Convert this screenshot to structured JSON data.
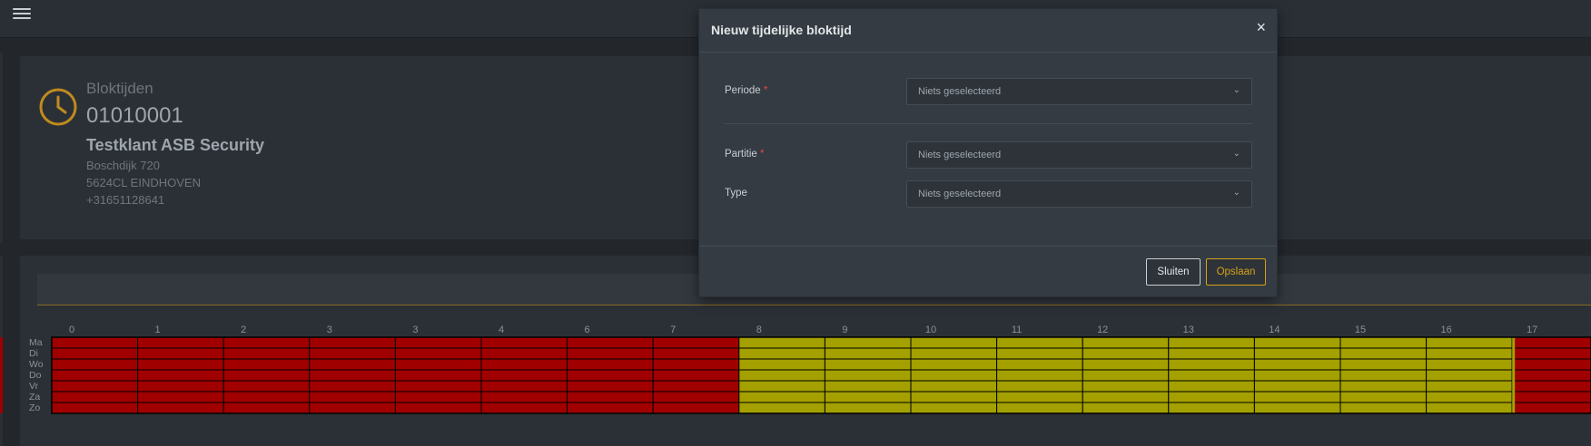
{
  "header": {
    "menu_icon": "hamburger-icon"
  },
  "info": {
    "label": "Bloktijden",
    "number": "01010001",
    "name": "Testklant ASB Security",
    "street": "Boschdijk 720",
    "city": "5624CL EINDHOVEN",
    "phone": "+31651128641",
    "icon": "clock-icon",
    "accent": "#c08a1e"
  },
  "grid": {
    "hour_labels": [
      "0",
      "1",
      "2",
      "3",
      "3",
      "4",
      "6",
      "7",
      "8",
      "9",
      "10",
      "11",
      "12",
      "13",
      "14",
      "15",
      "16",
      "17"
    ],
    "day_labels": [
      "Ma",
      "Di",
      "Wo",
      "Do",
      "Vr",
      "Za",
      "Zo"
    ],
    "colors": {
      "blocked": "#a10000",
      "open": "#a3a000"
    },
    "open_from_hour": 8,
    "open_until_hour": 17
  },
  "modal": {
    "title": "Nieuw tijdelijke bloktijd",
    "close_symbol": "×",
    "fields": [
      {
        "label": "Periode",
        "required": "*",
        "value": "Niets geselecteerd"
      },
      {
        "label": "Partitie",
        "required": "*",
        "value": "Niets geselecteerd"
      },
      {
        "label": "Type",
        "required": "",
        "value": "Niets geselecteerd"
      }
    ],
    "chevron": "⌄",
    "buttons": {
      "close": "Sluiten",
      "save": "Opslaan"
    }
  }
}
